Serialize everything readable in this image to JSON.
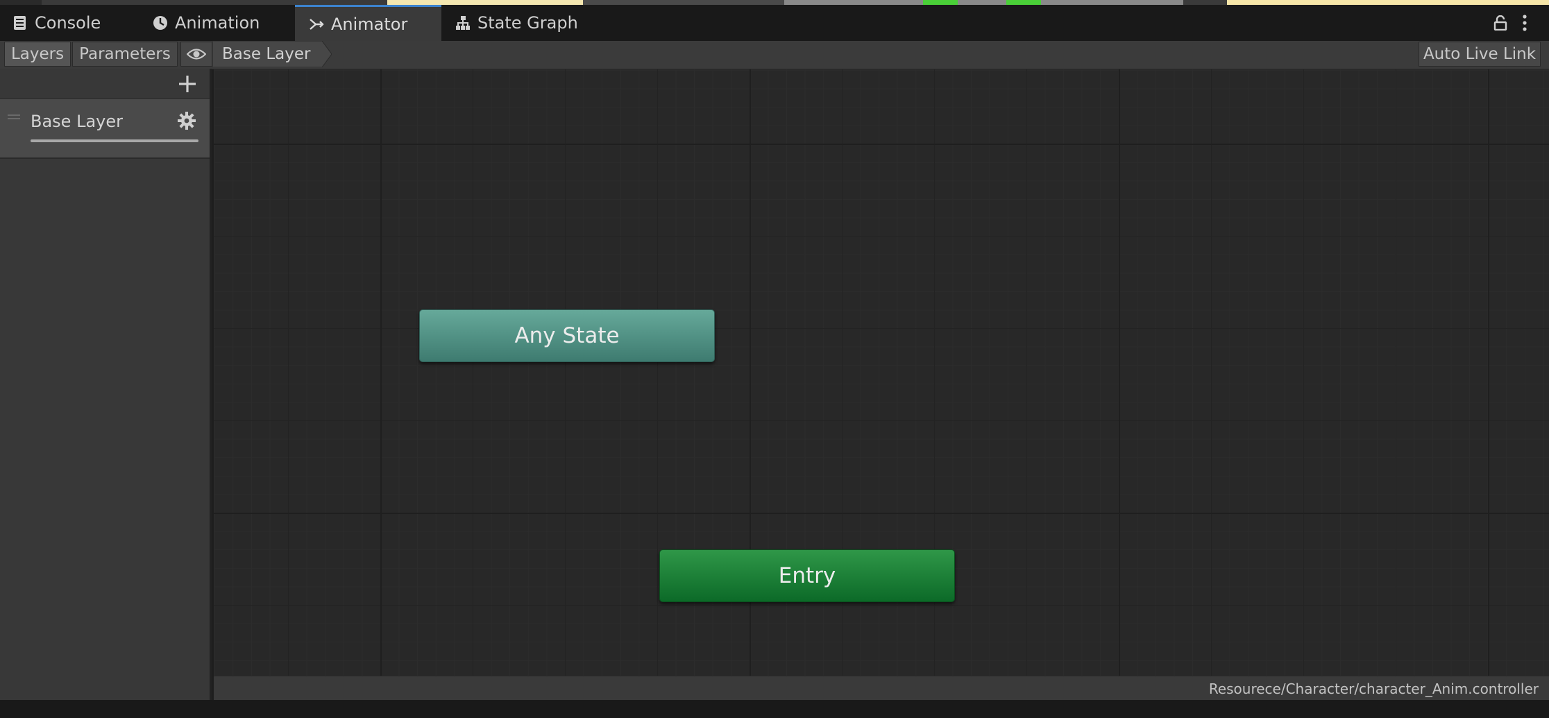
{
  "tabs": [
    {
      "label": "Console",
      "icon": "console-icon"
    },
    {
      "label": "Animation",
      "icon": "animation-clock-icon"
    },
    {
      "label": "Animator",
      "icon": "animator-icon",
      "active": true
    },
    {
      "label": "State Graph",
      "icon": "hierarchy-icon"
    }
  ],
  "toolbar": {
    "layers_label": "Layers",
    "parameters_label": "Parameters",
    "breadcrumb": "Base Layer",
    "live_link_label": "Auto Live Link"
  },
  "layers": [
    {
      "name": "Base Layer",
      "weight": 1.0
    }
  ],
  "graph": {
    "nodes": [
      {
        "id": "any-state",
        "label": "Any State",
        "color": "#4f9184"
      },
      {
        "id": "entry",
        "label": "Entry",
        "color": "#1c8038"
      }
    ]
  },
  "status": {
    "controller_path": "Resourece/Character/character_Anim.controller"
  },
  "colors": {
    "accent": "#3c83cf",
    "background": "#282828",
    "panel": "#383838"
  }
}
